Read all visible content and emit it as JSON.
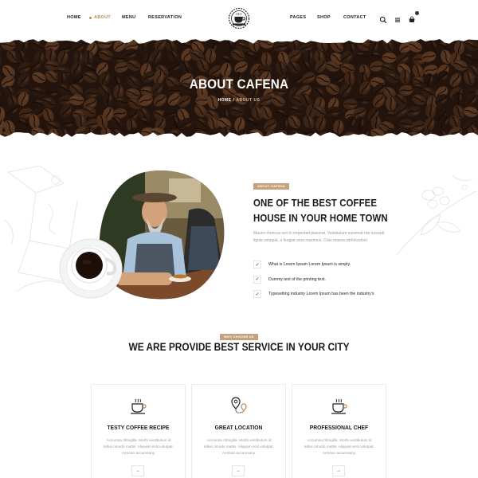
{
  "nav": {
    "left": [
      "HOME",
      "ABOUT",
      "MENU",
      "RESERVATION"
    ],
    "right": [
      "PAGES",
      "SHOP",
      "CONTACT"
    ],
    "active": "ABOUT"
  },
  "icons": [
    "search-icon",
    "menu-icon",
    "cart-icon",
    "logo-coffee-cup"
  ],
  "hero": {
    "title": "ABOUT CAFENA",
    "breadcrumb_home": "HOME",
    "breadcrumb_separator": "/",
    "breadcrumb_current": "ABOUT US"
  },
  "about": {
    "tag": "ABOUT CAFENA",
    "title": "ONE OF THE BEST COFFEE HOUSE IN YOUR HOME TOWN",
    "text": "Mauris rhoncus orci in imperdiet placerat. Vestibulum euismod nisl suscipit ligula volutpat, a feugiat urna maximus. Cras massa nibhincidunt",
    "checks": [
      "What is Lorem Ipsum Lorem Ipsum is simply.",
      "Dummy text of the printing text.",
      "Typesetting industry Lorem Ipsum has been the industry's"
    ]
  },
  "services": {
    "tag": "WHY CHOOSE US",
    "title": "WE ARE PROVIDE BEST SERVICE IN YOUR CITY",
    "cards": [
      {
        "title": "TESTY COFFEE RECIPE",
        "text": "Accumsa nfringilla. Morbi vestibulum id tellus nmodo mattis. Aliquam erat volutpat. Aenean accumsany.",
        "icon": "coffee-cup-icon",
        "arrow": "→"
      },
      {
        "title": "GREAT LOCATION",
        "text": "Accumsa nfringilla. Morbi vestibulum id tellus nmodo mattis. Aliquam erat volutpat. Aenean accumsany.",
        "icon": "location-pin-icon",
        "arrow": "→"
      },
      {
        "title": "PROFESSIONAL CHEF",
        "text": "Accumsa nfringilla. Morbi vestibulum id tellus nmodo mattis. Aliquam erat volutpat. Aenean accumsany.",
        "icon": "coffee-cup-icon",
        "arrow": "→"
      }
    ]
  },
  "check_mark": "✓",
  "colors": {
    "accent": "#b58a61",
    "tag_bg": "#c4a27e",
    "text_muted": "#9a9a9a",
    "hero_bg": "#2a1810"
  }
}
